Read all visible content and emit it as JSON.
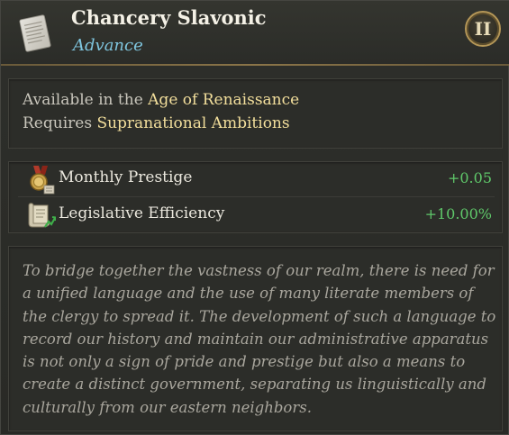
{
  "header": {
    "title": "Chancery Slavonic",
    "subtitle": "Advance",
    "tier": "II",
    "icon": "parchment-document-icon"
  },
  "requirements": {
    "available_prefix": "Available in the ",
    "age": "Age of Renaissance",
    "requires_prefix": "Requires ",
    "requirement": "Supranational Ambitions"
  },
  "modifiers": [
    {
      "icon": "prestige-medal-icon",
      "label": "Monthly Prestige",
      "value": "+0.05"
    },
    {
      "icon": "legislative-scroll-icon",
      "label": "Legislative Efficiency",
      "value": "+10.00%"
    }
  ],
  "description": "To bridge together the vastness of our realm, there is need for a unified language and the use of many literate members of the clergy to spread it. The development of such a language to record our history and maintain our administrative apparatus is not only a sign of pride and prestige but also a means to create a distinct government, separating us linguistically and culturally from our eastern neighbors.",
  "colors": {
    "title": "#f4f1e6",
    "subtitle": "#7fc6df",
    "highlight": "#f3df9c",
    "positive": "#5fc86a",
    "description": "#a9a69d"
  }
}
